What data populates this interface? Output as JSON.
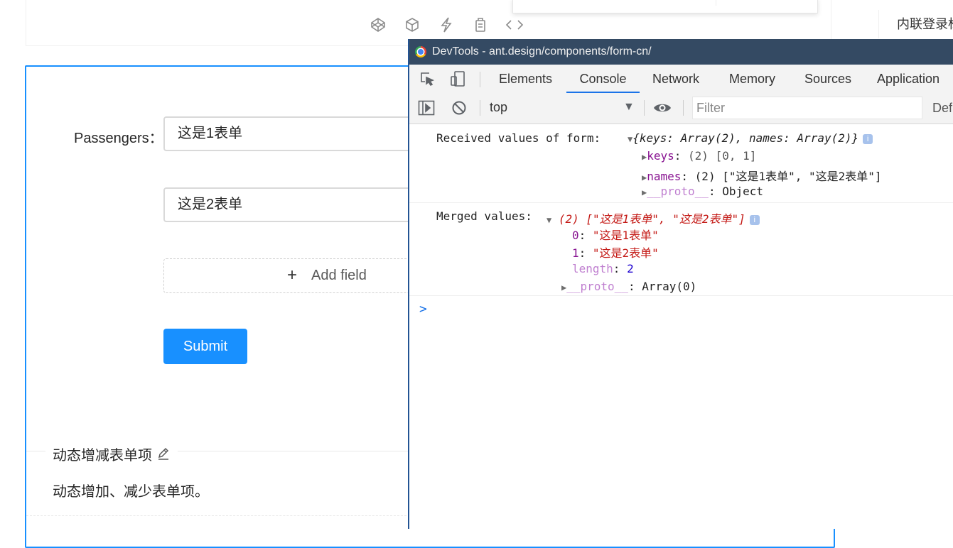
{
  "background_page": {
    "anchor_link": "内联登录标",
    "demo": {
      "form_label": "Passengers",
      "form_label_colon": "：",
      "input1_value": "这是1表单",
      "input2_value": "这是2表单",
      "add_field_icon": "+",
      "add_field_label": "Add field",
      "submit_label": "Submit",
      "meta_title": "动态增减表单项",
      "meta_description": "动态增加、减少表单项。"
    },
    "code_action_icons": [
      "codepen-icon",
      "codesandbox-icon",
      "stackblitz-icon",
      "copy-icon",
      "expand-code-icon"
    ]
  },
  "devtools": {
    "window_title": "DevTools - ant.design/components/form-cn/",
    "tabs": [
      {
        "label": "Elements"
      },
      {
        "label": "Console",
        "active": true
      },
      {
        "label": "Network"
      },
      {
        "label": "Memory"
      },
      {
        "label": "Sources"
      },
      {
        "label": "Application"
      }
    ],
    "toolbar": {
      "context": "top",
      "filter_placeholder": "Filter",
      "levels_label": "Def"
    },
    "console": {
      "msg1_prefix": "Received values of form: ",
      "msg1_summary": "{keys: Array(2), names: Array(2)}",
      "msg1_keys_label": "keys",
      "msg1_keys_value": "(2) [0, 1]",
      "msg1_names_label": "names",
      "msg1_names_value": "(2) [\"这是1表单\", \"这是2表单\"]",
      "msg1_proto_label": "__proto__",
      "msg1_proto_value": "Object",
      "msg2_prefix": "Merged values: ",
      "msg2_summary": "(2) [\"这是1表单\", \"这是2表单\"]",
      "msg2_item0_key": "0",
      "msg2_item0_value": "\"这是1表单\"",
      "msg2_item1_key": "1",
      "msg2_item1_value": "\"这是2表单\"",
      "msg2_length_key": "length",
      "msg2_length_value": "2",
      "msg2_proto_label": "__proto__",
      "msg2_proto_value": "Array(0)",
      "prompt_symbol": ">",
      "info_badge": "i"
    }
  },
  "colors": {
    "primary": "#1890ff",
    "devtools_titlebar": "#344a63",
    "devtools_active_tab": "#1a73e8"
  }
}
